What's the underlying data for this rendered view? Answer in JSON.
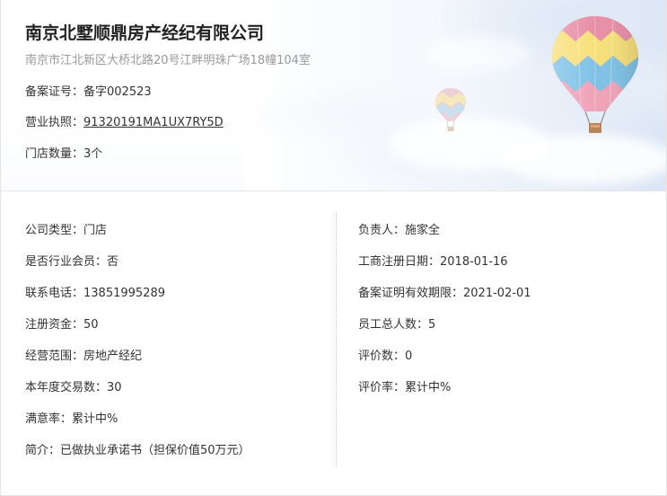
{
  "header": {
    "company_name": "南京北墅顺鼎房产经纪有限公司",
    "address": "南京市江北新区大桥北路20号江畔明珠广场18幢104室",
    "filing_label": "备案证号：",
    "filing_value": "备字002523",
    "license_label": "营业执照：",
    "license_value": "91320191MA1UX7RY5D",
    "stores_label": "门店数量：",
    "stores_value": "3个"
  },
  "details": {
    "left": [
      {
        "label": "公司类型：",
        "value": "门店"
      },
      {
        "label": "是否行业会员：",
        "value": "否"
      },
      {
        "label": "联系电话：",
        "value": "13851995289"
      },
      {
        "label": "注册资金：",
        "value": "50"
      },
      {
        "label": "经营范围：",
        "value": "房地产经纪"
      },
      {
        "label": "本年度交易数：",
        "value": "30"
      },
      {
        "label": "满意率：",
        "value": "累计中%"
      },
      {
        "label": "简介：",
        "value": "已做执业承诺书（担保价值50万元）"
      }
    ],
    "right": [
      {
        "label": "负责人：",
        "value": "施家全"
      },
      {
        "label": "工商注册日期：",
        "value": "2018-01-16"
      },
      {
        "label": "备案证明有效期限：",
        "value": "2021-02-01"
      },
      {
        "label": "员工总人数：",
        "value": "5"
      },
      {
        "label": "评价数：",
        "value": "0"
      },
      {
        "label": "评价率：",
        "value": "累计中%"
      }
    ]
  },
  "decor": {
    "balloon_large_icon": "hot-air-balloon-icon",
    "balloon_small_icon": "hot-air-balloon-icon",
    "colors": {
      "title": "#222222",
      "address": "#999999",
      "text": "#333333",
      "divider": "#cccccc"
    }
  }
}
